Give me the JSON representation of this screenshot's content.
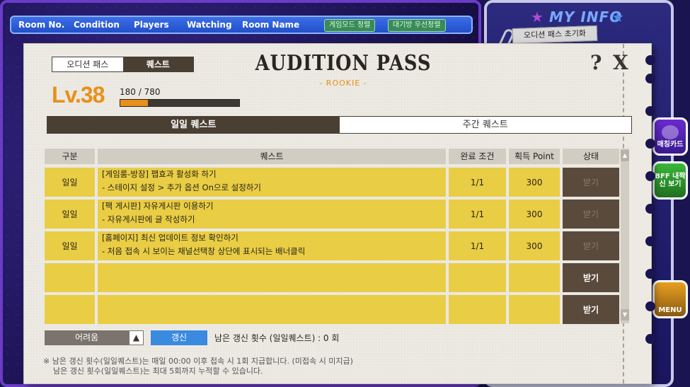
{
  "lobby": {
    "columns": [
      "Room No.",
      "Condition",
      "Players",
      "Watching",
      "Room Name"
    ],
    "buttons": [
      "게임모드 정렬",
      "대기방 우선정렬"
    ]
  },
  "side": {
    "my_info": "MY INFO",
    "pass_reset": "오디션 패스 초기화",
    "match_card": "매칭카드",
    "bff": "BFF 내짝신 보기",
    "menu": "MENU"
  },
  "modal": {
    "tabs": [
      "오디션 패스",
      "퀘스트"
    ],
    "title": "AUDITION PASS",
    "subtitle": "- ROOKIE -",
    "help": "?",
    "close": "X",
    "level": "Lv.38",
    "xp_text": "180 / 780",
    "xp_fraction": 0.2308,
    "quest_tabs": [
      "일일 퀘스트",
      "주간 퀘스트"
    ],
    "table": {
      "headers": [
        "구분",
        "퀘스트",
        "완료 조건",
        "획득 Point",
        "상태"
      ],
      "rows": [
        {
          "type": "일일",
          "line1": "[게임룸-방장] 팹효과 활성화 하기",
          "line2": "- 스테이지 설정 > 추가 옵션 On으로 설정하기",
          "condition": "1/1",
          "point": "300",
          "status": "받기",
          "claimed": true
        },
        {
          "type": "일일",
          "line1": "[팩 게시판] 자유게시판 이용하기",
          "line2": "- 자유게시판에 글 작성하기",
          "condition": "1/1",
          "point": "300",
          "status": "받기",
          "claimed": true
        },
        {
          "type": "일일",
          "line1": "[홈페이지] 최신 업데이트 정보 확인하기",
          "line2": "- 처음 접속 시 보이는 채널선택창 상단에 표시되는 배너클릭",
          "condition": "1/1",
          "point": "300",
          "status": "받기",
          "claimed": true
        },
        {
          "type": "",
          "line1": "",
          "line2": "",
          "condition": "",
          "point": "",
          "status": "받기",
          "claimed": false
        },
        {
          "type": "",
          "line1": "",
          "line2": "",
          "condition": "",
          "point": "",
          "status": "받기",
          "claimed": false
        }
      ]
    },
    "difficulty": "어려움",
    "refresh_label": "갱신",
    "refresh_count": "남은 갱신 횟수 (일일퀘스트) : 0 회",
    "note1": "※ 남은 갱신 횟수(일일퀘스트)는 매일 00:00 이후 접속 시 1회 지급합니다. (미접속 시 미지급)",
    "note2": "남은 갱신 횟수(일일퀘스트)는 최대 5회까지 누적할 수 있습니다."
  }
}
